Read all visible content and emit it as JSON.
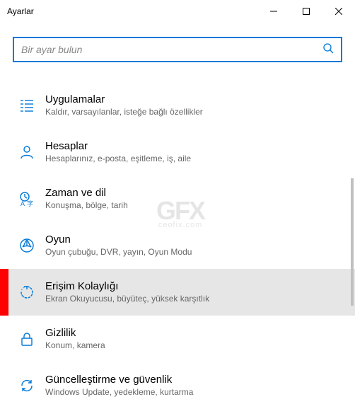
{
  "window": {
    "title": "Ayarlar"
  },
  "search": {
    "placeholder": "Bir ayar bulun",
    "value": ""
  },
  "categories": [
    {
      "id": "apps",
      "title": "Uygulamalar",
      "desc": "Kaldır, varsayılanlar, isteğe bağlı özellikler",
      "selected": false
    },
    {
      "id": "accounts",
      "title": "Hesaplar",
      "desc": "Hesaplarınız, e-posta, eşitleme, iş, aile",
      "selected": false
    },
    {
      "id": "time",
      "title": "Zaman ve dil",
      "desc": "Konuşma, bölge, tarih",
      "selected": false
    },
    {
      "id": "gaming",
      "title": "Oyun",
      "desc": "Oyun çubuğu, DVR, yayın, Oyun Modu",
      "selected": false
    },
    {
      "id": "ease",
      "title": "Erişim Kolaylığı",
      "desc": "Ekran Okuyucusu, büyüteç, yüksek karşıtlık",
      "selected": true
    },
    {
      "id": "privacy",
      "title": "Gizlilik",
      "desc": "Konum, kamera",
      "selected": false
    },
    {
      "id": "update",
      "title": "Güncelleştirme ve güvenlik",
      "desc": "Windows Update, yedekleme, kurtarma",
      "selected": false
    }
  ],
  "watermark": {
    "line1": "GFX",
    "line2": "ceofix.com"
  }
}
